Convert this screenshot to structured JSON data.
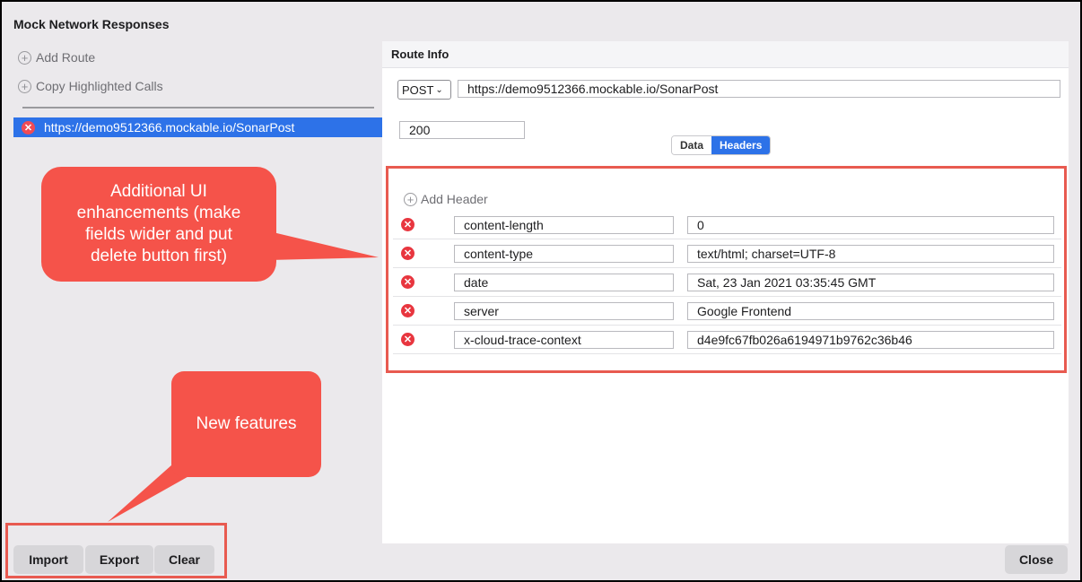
{
  "window": {
    "title": "Mock Network Responses"
  },
  "sidebar": {
    "add_route_label": "Add Route",
    "copy_calls_label": "Copy Highlighted Calls",
    "routes": [
      {
        "url": "https://demo9512366.mockable.io/SonarPost",
        "selected": true
      }
    ]
  },
  "route_info": {
    "title": "Route Info",
    "method": "POST",
    "url": "https://demo9512366.mockable.io/SonarPost",
    "status": "200",
    "tabs": [
      {
        "label": "Data",
        "active": false
      },
      {
        "label": "Headers",
        "active": true
      }
    ],
    "add_header_label": "Add Header",
    "headers": [
      {
        "key": "content-length",
        "value": "0"
      },
      {
        "key": "content-type",
        "value": "text/html; charset=UTF-8"
      },
      {
        "key": "date",
        "value": "Sat, 23 Jan 2021 03:35:45 GMT"
      },
      {
        "key": "server",
        "value": "Google Frontend"
      },
      {
        "key": "x-cloud-trace-context",
        "value": "d4e9fc67fb026a6194971b9762c36b46"
      }
    ]
  },
  "footer": {
    "import_label": "Import",
    "export_label": "Export",
    "clear_label": "Clear",
    "close_label": "Close"
  },
  "annotations": {
    "ui_enhancements": "Additional UI enhancements (make fields wider and put delete button first)",
    "new_features": "New features",
    "accent_color": "#f5534a"
  },
  "colors": {
    "selection": "#2d72e8",
    "delete": "#e8363f"
  }
}
